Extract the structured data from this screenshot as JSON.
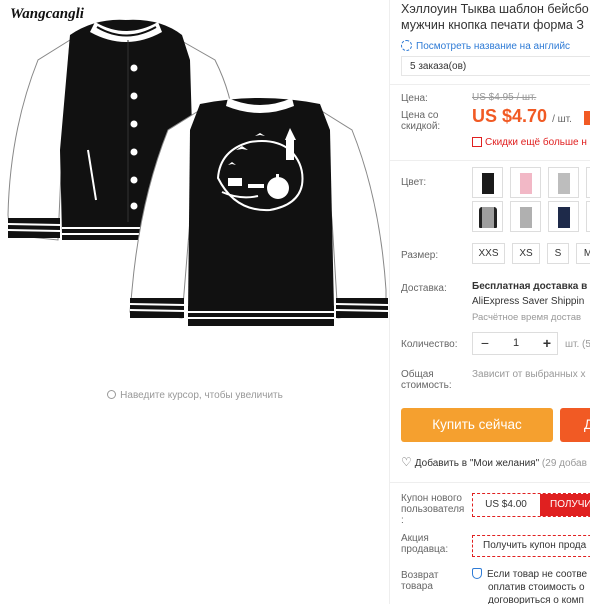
{
  "gallery": {
    "brand_watermark": "Wangcangli",
    "zoom_hint": "Наведите курсор, чтобы увеличить",
    "colors": {
      "jacket_body": "#111111",
      "jacket_sleeves": "#ffffff",
      "print": "#ffffff"
    }
  },
  "product": {
    "title_line1": "Хэллоуин Тыква шаблон бейсбо",
    "title_line2": "мужчин кнопка печати форма З",
    "translate_link": "Посмотреть название на английс",
    "orders": "5 заказа(ов)"
  },
  "price": {
    "label": "Цена:",
    "old": "US $4.95 / шт.",
    "label_discount_line1": "Цена со",
    "label_discount_line2": "скидкой:",
    "new": "US $4.70",
    "unit": "/ шт.",
    "bulk_discount": "Скидки ещё больше н",
    "accent_color": "#f15a24"
  },
  "color": {
    "label": "Цвет:",
    "swatches": [
      {
        "name": "black-white",
        "body": "#1a1a1a",
        "selected": false
      },
      {
        "name": "pink",
        "body": "#f2b8c6",
        "selected": false
      },
      {
        "name": "gray-white",
        "body": "#bdbdbd",
        "selected": false
      },
      {
        "name": "gray-black",
        "body": "#9e9e9e",
        "selected": false
      },
      {
        "name": "gray",
        "body": "#b0b0b0",
        "selected": false
      },
      {
        "name": "navy",
        "body": "#1e2a4a",
        "selected": false
      },
      {
        "name": "black",
        "body": "#111111",
        "selected": false
      }
    ]
  },
  "size": {
    "label": "Размер:",
    "options": [
      "XXS",
      "XS",
      "S",
      "M"
    ]
  },
  "shipping": {
    "label": "Доставка:",
    "title": "Бесплатная доставка в",
    "method": "AliExpress Saver Shippin",
    "estimate": "Расчётное время достав"
  },
  "quantity": {
    "label": "Количество:",
    "value": "1",
    "minus": "−",
    "plus": "+",
    "unit": "шт. (5"
  },
  "total": {
    "label_line1": "Общая",
    "label_line2": "стоимость:",
    "note": "Зависит от выбранных х"
  },
  "actions": {
    "buy_now": "Купить сейчас",
    "add_to_cart": "Д",
    "wishlist": "Добавить в \"Мои желания\"",
    "wishlist_count": "(29 добав"
  },
  "coupon": {
    "label_line1": "Купон нового",
    "label_line2": "пользователя",
    "label_line3": ":",
    "amount": "US $4.00",
    "get": "ПОЛУЧИТЬ"
  },
  "seller_promo": {
    "label_line1": "Акция",
    "label_line2": "продавца:",
    "text": "Получить купон прода"
  },
  "returns": {
    "label_line1": "Возврат",
    "label_line2": "товара",
    "line1": "Если товар не соотве",
    "line2": "оплатив стоимость о",
    "line3": "договориться о комп"
  }
}
